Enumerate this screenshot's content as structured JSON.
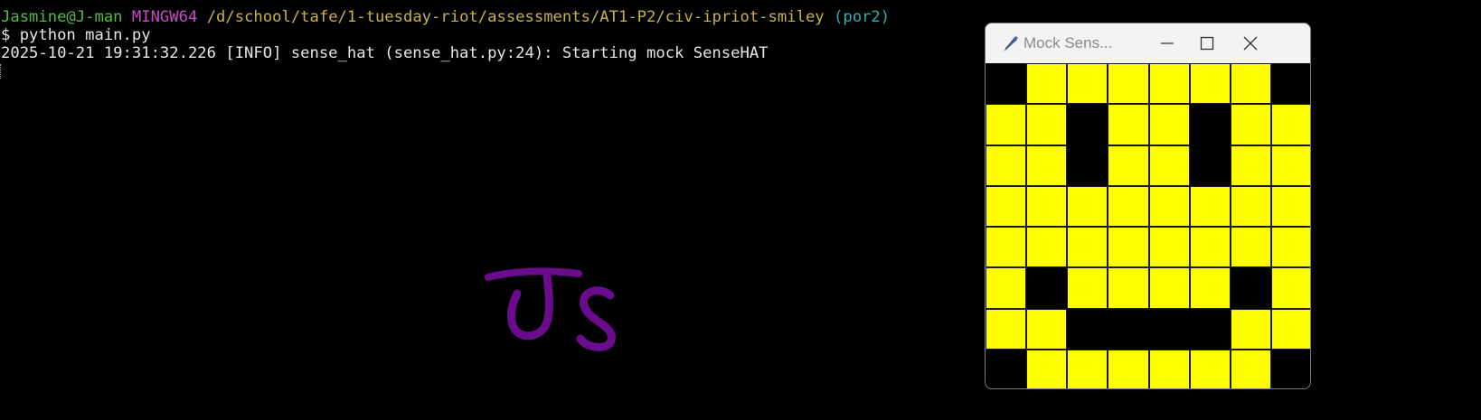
{
  "terminal": {
    "prompt": {
      "user_host": "Jasmine@J-man",
      "shell": "MINGW64",
      "path": "/d/school/tafe/1-tuesday-riot/assessments/AT1-P2/civ-ipriot-smiley",
      "branch": "(por2)"
    },
    "command_line": "$ python main.py",
    "log_line": "2025-10-21 19:31:32.226 [INFO] sense_hat (sense_hat.py:24): Starting mock SenseHAT"
  },
  "annotation": {
    "handwriting": "Js",
    "color": "#6a0c8c"
  },
  "mock_window": {
    "title": "Mock Sens...",
    "app_icon": "feather-icon",
    "minimize_icon": "minimize-icon",
    "maximize_icon": "maximize-icon",
    "close_icon": "close-icon",
    "led_on_color": "#ffff00",
    "led_off_color": "#000000",
    "led_matrix": [
      [
        0,
        1,
        1,
        1,
        1,
        1,
        1,
        0
      ],
      [
        1,
        1,
        0,
        1,
        1,
        0,
        1,
        1
      ],
      [
        1,
        1,
        0,
        1,
        1,
        0,
        1,
        1
      ],
      [
        1,
        1,
        1,
        1,
        1,
        1,
        1,
        1
      ],
      [
        1,
        1,
        1,
        1,
        1,
        1,
        1,
        1
      ],
      [
        1,
        0,
        1,
        1,
        1,
        1,
        0,
        1
      ],
      [
        1,
        1,
        0,
        0,
        0,
        0,
        1,
        1
      ],
      [
        0,
        1,
        1,
        1,
        1,
        1,
        1,
        0
      ]
    ]
  }
}
